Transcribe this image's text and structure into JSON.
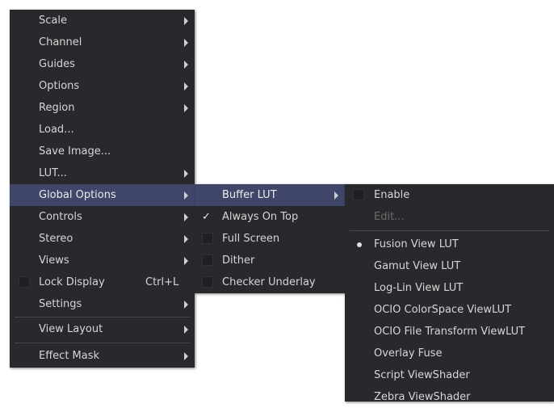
{
  "main_menu": {
    "scale": "Scale",
    "channel": "Channel",
    "guides": "Guides",
    "options": "Options",
    "region": "Region",
    "load": "Load...",
    "save_image": "Save Image...",
    "lut": "LUT...",
    "global_options": "Global Options",
    "controls": "Controls",
    "stereo": "Stereo",
    "views": "Views",
    "lock_display": "Lock Display",
    "lock_display_shortcut": "Ctrl+L",
    "settings": "Settings",
    "view_layout": "View Layout",
    "effect_mask": "Effect Mask"
  },
  "global_options_menu": {
    "buffer_lut": "Buffer LUT",
    "always_on_top": "Always On Top",
    "always_on_top_checked": true,
    "full_screen": "Full Screen",
    "dither": "Dither",
    "checker_underlay": "Checker Underlay"
  },
  "buffer_lut_menu": {
    "enable": "Enable",
    "edit": "Edit...",
    "fusion_view_lut": "Fusion View LUT",
    "gamut_view_lut": "Gamut View LUT",
    "log_lin_view_lut": "Log-Lin View LUT",
    "ocio_colorspace_viewlut": "OCIO ColorSpace ViewLUT",
    "ocio_file_transform_viewlut": "OCIO File Transform ViewLUT",
    "overlay_fuse": "Overlay Fuse",
    "script_viewshader": "Script ViewShader",
    "zebra_viewshader": "Zebra ViewShader",
    "selected": "Fusion View LUT"
  },
  "icons": {
    "submenu_arrow": "chevron-right-icon",
    "check": "check-icon",
    "radio": "radio-dot-icon"
  },
  "colors": {
    "menu_bg": "#28292c",
    "highlight": "#3f4669",
    "checkbox_bg": "#1f2022"
  }
}
